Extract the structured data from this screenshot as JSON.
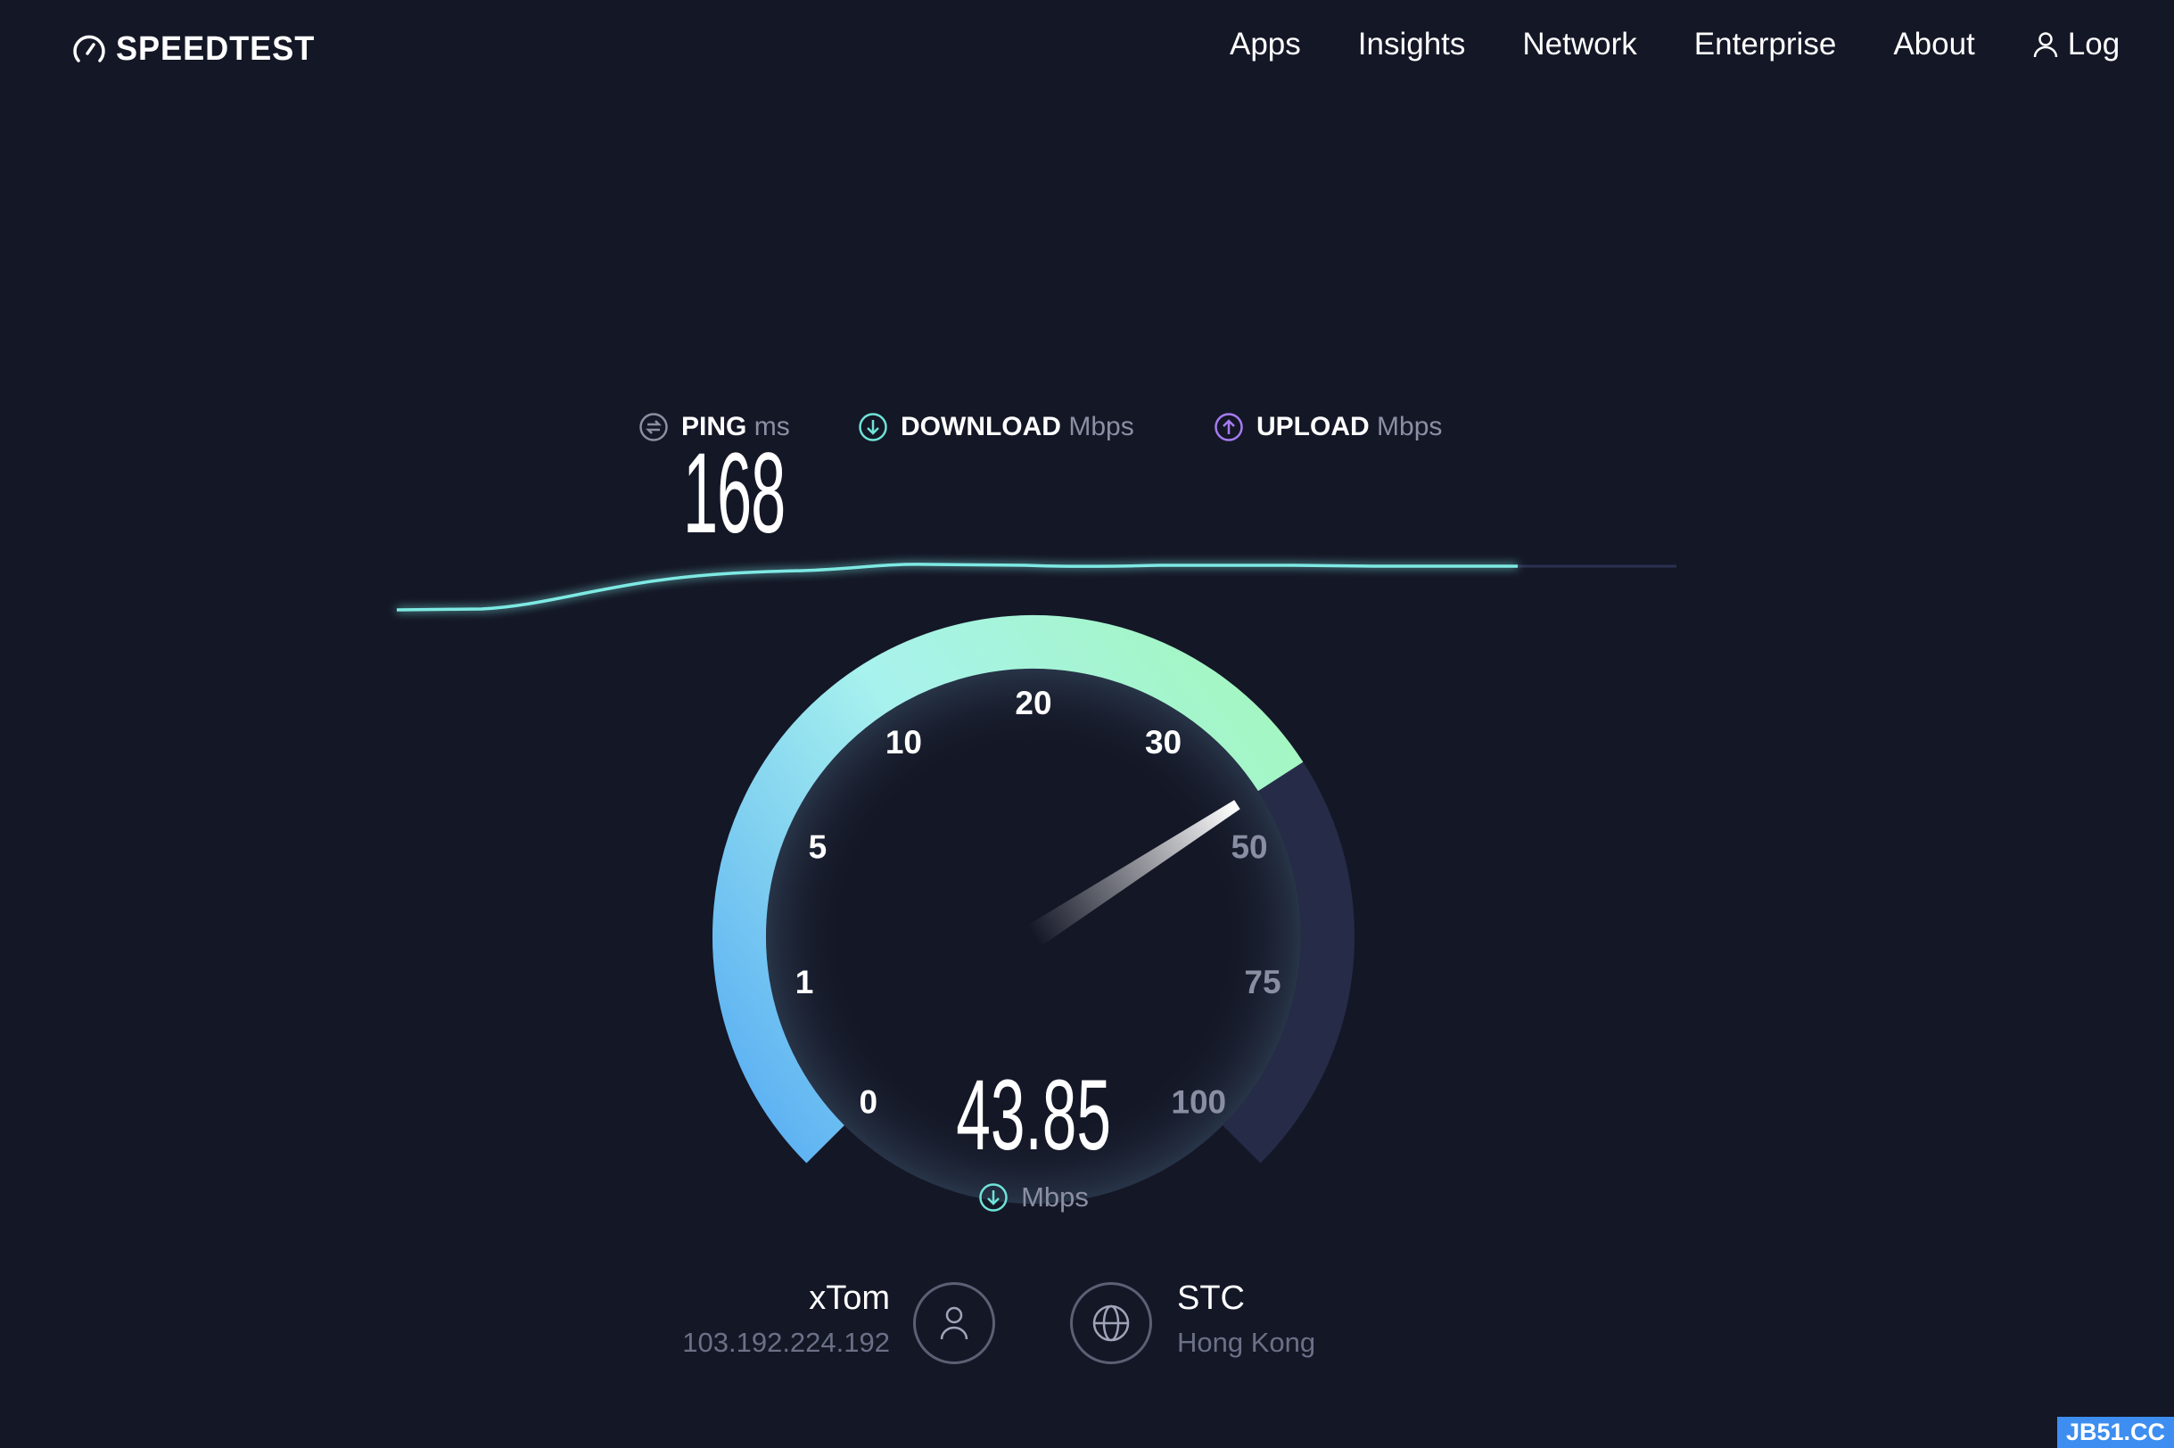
{
  "header": {
    "logo_text": "SPEEDTEST",
    "nav": [
      "Apps",
      "Insights",
      "Network",
      "Enterprise",
      "About"
    ],
    "login_label": "Log"
  },
  "metrics": {
    "ping": {
      "label": "PING",
      "unit": "ms",
      "value": "168",
      "icon": "ping-icon",
      "color": "#8c8fa3"
    },
    "download": {
      "label": "DOWNLOAD",
      "unit": "Mbps",
      "icon": "download-icon",
      "color": "#6fe3d8"
    },
    "upload": {
      "label": "UPLOAD",
      "unit": "Mbps",
      "icon": "upload-icon",
      "color": "#a67cf0"
    }
  },
  "gauge": {
    "value": 43.85,
    "value_text": "43.85",
    "unit": "Mbps",
    "ticks": [
      "0",
      "1",
      "5",
      "10",
      "20",
      "30",
      "50",
      "75",
      "100"
    ],
    "colors": {
      "start": "#5aaff3",
      "mid": "#a8f2ee",
      "end": "#a4f6c2",
      "track": "#262c47"
    }
  },
  "server": {
    "isp_name": "xTom",
    "ip": "103.192.224.192",
    "host_name": "STC",
    "host_location": "Hong Kong"
  },
  "watermark": "JB51.CC"
}
